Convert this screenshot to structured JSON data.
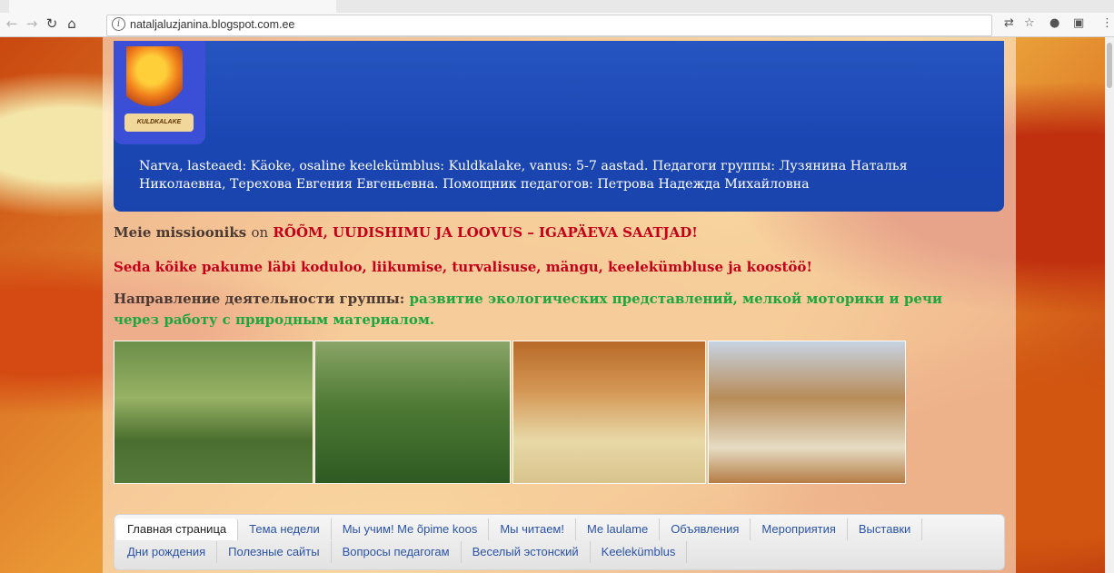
{
  "browser": {
    "url": "nataljaluzjanina.blogspot.com.ee",
    "icons": [
      "back-icon",
      "forward-icon",
      "reload-icon",
      "home-icon",
      "info-icon",
      "translate-icon",
      "star-icon",
      "extension-icon",
      "cast-icon",
      "menu-icon"
    ]
  },
  "header": {
    "logo_label": "KULDKALAKE",
    "description": "Narva, lasteaed: Käoke, osaline keelekümblus: Kuldkalake, vanus: 5-7 aastad. Педагоги группы: Лузянина Наталья Николаевна, Терехова Евгения Евгеньевна. Помощник педагогов: Петрова Надежда Михайловна"
  },
  "intro": {
    "mission_lead": "Meie missiooniks",
    "mission_on": "on",
    "mission_motto": "RÕÕM, UUDISHIMU JA LOOVUS – IGAPÄEVA SAATJAD!",
    "offer": "Seda kõike pakume läbi koduloo, liikumise, turvalisuse, mängu, keelekümbluse ja koostöö!",
    "direction_lead": "Направление деятельности группы:",
    "direction_text": "развитие экологических представлений, мелкой моторики и речи через работу с природным материалом."
  },
  "photos": [
    "group-photo-outdoors",
    "children-with-teacher-by-pond",
    "child-at-table",
    "children-at-round-table"
  ],
  "nav": {
    "row1": [
      "Главная страница",
      "Тема недели",
      "Мы учим! Me õpime koos",
      "Мы читаем!",
      "Me laulame",
      "Объявления",
      "Мероприятия",
      "Выставки"
    ],
    "row2": [
      "Дни рождения",
      "Полезные сайты",
      "Вопросы педагогам",
      "Веселый эстонский",
      "Keelekümblus"
    ],
    "active": "Главная страница"
  },
  "colors": {
    "header_blue": "#1a46b2",
    "motto_red": "#c4001a",
    "direction_green": "#1fa63e",
    "nav_link": "#2a53a8"
  }
}
